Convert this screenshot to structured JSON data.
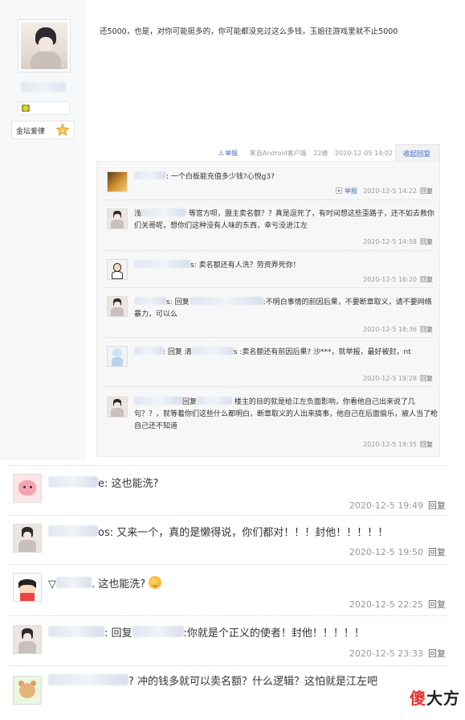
{
  "main_post": {
    "text": "还5000，也是，对你可能挺多的，你可能都没充过这么多钱，玉姐往游戏里就不止5000",
    "author_award_label": "金坛爱律",
    "tail": {
      "report": "举报",
      "client": "来自Android客户端",
      "floor": "22楼",
      "time": "2020-12-05 14:02",
      "toggle_replies": "收起回复"
    }
  },
  "lzl_replies": [
    {
      "text_suffix": ": 一个白板能充值多少钱?心悦g3?",
      "report": "举报",
      "time": "2020-12-5 14:22",
      "reply": "回复"
    },
    {
      "text_prefix": "浅",
      "text_suffix": "等官方呗，盟主卖名额？？真是逗死了，有时间想这些歪路子，还不如去救你们关哥呢，想你们这种没有人味的东西，幸亏没进江左",
      "time": "2020-12-5 14:58",
      "reply": "回复"
    },
    {
      "text_suffix": "s: 卖名额还有人洗？劳资弄死你！",
      "time": "2020-12-5 16:20",
      "reply": "回复"
    },
    {
      "text_prefix": "s: 回复",
      "text_suffix": ":不明白事情的前因后果，不要断章取义，请不要网络暴力，可以么",
      "time": "2020-12-5 18:36",
      "reply": "回复"
    },
    {
      "text_prefix": ": 回复 清",
      "text_suffix": "s :卖名额还有前因后果? 沙***，就举报，最好被封，nt",
      "time": "2020-12-5 19:28",
      "reply": "回复"
    },
    {
      "text_prefix": "回复",
      "text_suffix": "楼主的目的就是给江左负面影响，你看他自己出来说了几句？？，就等着你们这些什么都明白，断章取义的人出来搞事，他自己在后面偷乐，被人当了枪自己还不知道",
      "time": "2020-12-5 19:35",
      "reply": "回复"
    }
  ],
  "floors": [
    {
      "text": "e: 这也能洗?",
      "time": "2020-12-5 19:49",
      "reply": "回复"
    },
    {
      "text": "os: 又来一个，真的是懒得说，你们都对！！！封他！！！！！",
      "time": "2020-12-5 19:50",
      "reply": "回复"
    },
    {
      "text_prefix": "▽",
      "text": ". 这也能洗?",
      "time": "2020-12-5 22:25",
      "reply": "回复"
    },
    {
      "text_prefix": ": 回复",
      "text": ":你就是个正义的使者！封他！！！！！",
      "time": "2020-12-5 23:33",
      "reply": "回复"
    },
    {
      "text": "? 冲的钱多就可以卖名额？什么逻辑？这怕就是江左吧",
      "time": "",
      "reply": ""
    }
  ],
  "watermark": {
    "char1": "傻",
    "char2": "大方"
  },
  "colors": {
    "link": "#3f6dc2",
    "muted": "#999999",
    "watermark_red": "#e8322e"
  }
}
